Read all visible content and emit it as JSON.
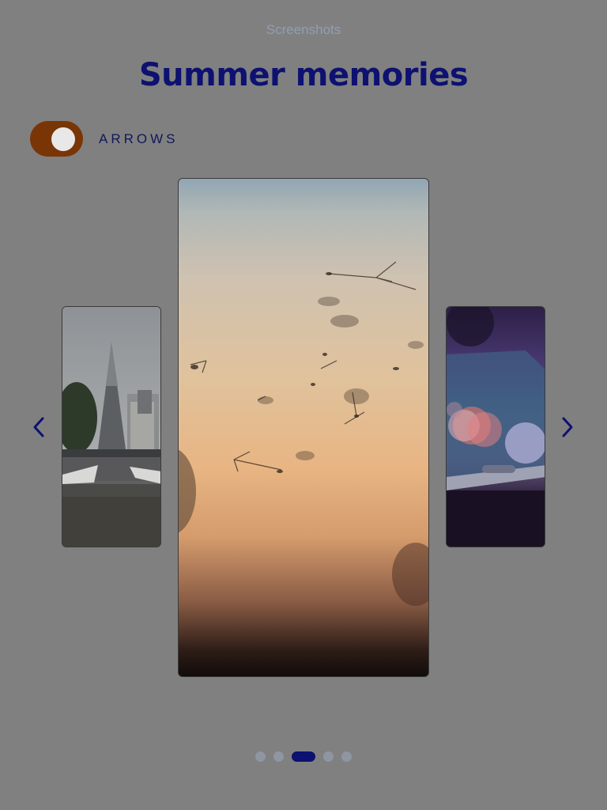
{
  "header": {
    "eyebrow": "Screenshots",
    "title": "Summer memories"
  },
  "toggle": {
    "label": "ARROWS",
    "on": true,
    "color": "#7a3506"
  },
  "carousel": {
    "slides": [
      {
        "name": "city-tower-photo"
      },
      {
        "name": "dandelion-sunset-photo"
      },
      {
        "name": "phone-bokeh-photo"
      }
    ],
    "active_index": 2,
    "total": 5,
    "arrow_color": "#0d1170"
  },
  "colors": {
    "background": "#808080",
    "title": "#0d1170",
    "eyebrow": "#8f9fb4",
    "dot_inactive": "#8e96a3",
    "dot_active": "#0d1170"
  }
}
